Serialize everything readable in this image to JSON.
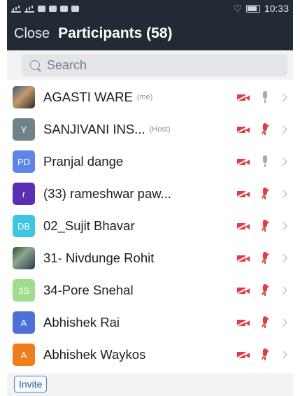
{
  "status": {
    "time": "10:33"
  },
  "header": {
    "close_label": "Close",
    "title": "Participants (58)"
  },
  "search": {
    "placeholder": "Search"
  },
  "participants": [
    {
      "name": "AGASTI WARE",
      "tag": "(me)",
      "initials": "",
      "avatar": "photo",
      "avatar_color": "",
      "mic": "on"
    },
    {
      "name": "SANJIVANI INS...",
      "tag": "(Host)",
      "initials": "Y",
      "avatar": "initials",
      "avatar_color": "#6f8287",
      "mic": "muted"
    },
    {
      "name": "Pranjal dange",
      "tag": "",
      "initials": "PD",
      "avatar": "initials",
      "avatar_color": "#5f86e6",
      "mic": "on"
    },
    {
      "name": "(33) rameshwar paw...",
      "tag": "",
      "initials": "r",
      "avatar": "initials",
      "avatar_color": "#5b2fb3",
      "mic": "muted"
    },
    {
      "name": "02_Sujit Bhavar",
      "tag": "",
      "initials": "DB",
      "avatar": "initials",
      "avatar_color": "#3cc6e2",
      "mic": "muted"
    },
    {
      "name": "31- Nivdunge Rohit",
      "tag": "",
      "initials": "",
      "avatar": "photo",
      "avatar_color": "",
      "mic": "muted"
    },
    {
      "name": "34-Pore Snehal",
      "tag": "",
      "initials": "3S",
      "avatar": "initials",
      "avatar_color": "#9fdc8c",
      "mic": "muted"
    },
    {
      "name": "Abhishek Rai",
      "tag": "",
      "initials": "A",
      "avatar": "initials",
      "avatar_color": "#4d6fd8",
      "mic": "muted"
    },
    {
      "name": "Abhishek Waykos",
      "tag": "",
      "initials": "A",
      "avatar": "initials",
      "avatar_color": "#ef7d1c",
      "mic": "muted"
    }
  ],
  "footer": {
    "invite_label": "Invite"
  },
  "colors": {
    "header_bg": "#212a35",
    "muted_red": "#e53a45",
    "invite_blue": "#2f5da6"
  }
}
